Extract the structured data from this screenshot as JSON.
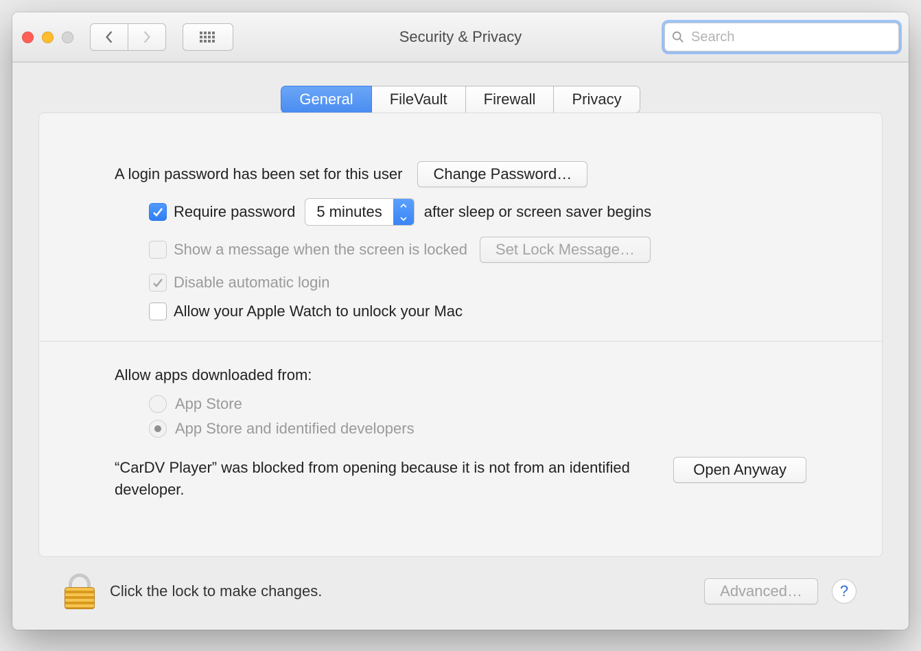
{
  "window": {
    "title": "Security & Privacy"
  },
  "search": {
    "placeholder": "Search"
  },
  "tabs": [
    {
      "label": "General",
      "selected": true
    },
    {
      "label": "FileVault",
      "selected": false
    },
    {
      "label": "Firewall",
      "selected": false
    },
    {
      "label": "Privacy",
      "selected": false
    }
  ],
  "login": {
    "message": "A login password has been set for this user",
    "change_button": "Change Password…"
  },
  "require_password": {
    "checked": true,
    "label_before": "Require password",
    "delay_value": "5 minutes",
    "label_after": "after sleep or screen saver begins"
  },
  "show_message": {
    "checked": false,
    "enabled": false,
    "label": "Show a message when the screen is locked",
    "button": "Set Lock Message…"
  },
  "disable_auto_login": {
    "checked": true,
    "enabled": false,
    "label": "Disable automatic login"
  },
  "apple_watch": {
    "checked": false,
    "label": "Allow your Apple Watch to unlock your Mac"
  },
  "allow_apps": {
    "heading": "Allow apps downloaded from:",
    "options": [
      {
        "label": "App Store",
        "selected": false
      },
      {
        "label": "App Store and identified developers",
        "selected": true
      }
    ],
    "enabled": false
  },
  "blocked": {
    "message": "“CarDV Player” was blocked from opening because it is not from an identified developer.",
    "button": "Open Anyway"
  },
  "footer": {
    "lock_text": "Click the lock to make changes.",
    "advanced": "Advanced…",
    "help": "?"
  }
}
